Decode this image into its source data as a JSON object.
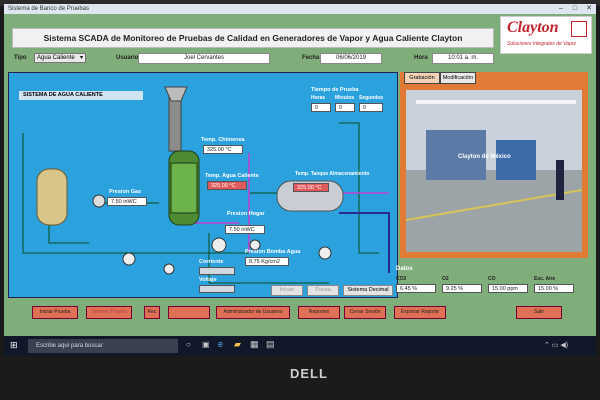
{
  "window": {
    "title": "Sistema de Banco de Pruebas"
  },
  "header": {
    "title": "Sistema SCADA de Monitoreo de Pruebas de Calidad en Generadores de Vapor y Agua Caliente Clayton",
    "logo_text": "Clayton",
    "logo_tagline": "Soluciones Integrales de Vapor"
  },
  "info": {
    "tipo_label": "Tipo",
    "tipo_value": "Agua Caliente",
    "usuario_label": "Usuario",
    "usuario_value": "Joel Cervantes",
    "fecha_label": "Fecha",
    "fecha_value": "06/06/2019",
    "hora_label": "Hora",
    "hora_value": "10:01 a. m."
  },
  "process": {
    "panel_title": "SISTEMA DE AGUA CALIENTE",
    "tiempo_label": "Tiempo de Prueba",
    "tiempo_cols": [
      "Horas",
      "Minutos",
      "Segundos"
    ],
    "tiempo_vals": [
      "0",
      "0",
      "0"
    ],
    "temp_chimenea_label": "Temp. Chimenea",
    "temp_chimenea": "325.00 °C",
    "temp_agua_label": "Temp. Agua Caliente",
    "temp_agua": "325.00 °C",
    "temp_tanque_label": "Temp. Tanque Almacenamiento",
    "temp_tanque": "325.00 °C",
    "presion_gas_label": "Presion Gas",
    "presion_gas": "7.50 inWC",
    "presion_hogar_label": "Presion Hogar",
    "presion_hogar": "7.50 inWC",
    "presion_bomba_label": "Presion Bomba Agua",
    "presion_bomba": "8.75 Kg/cm2",
    "corriente_label": "Corriente",
    "voltaje_label": "Voltaje",
    "btn_start": "Iniciar",
    "btn_pause": "Pausa",
    "sistema_decimal": "Sistema Decimal"
  },
  "camera": {
    "tabs": [
      "Grabación",
      "Modificación"
    ],
    "overlay_text": "Clayton de México"
  },
  "datos": {
    "title": "Datos",
    "cols": [
      "CO2",
      "O2",
      "CO",
      "Exc. Aire"
    ],
    "vals": [
      "6.45 %",
      "9.25 %",
      "15.00 ppm",
      "15.00 %"
    ]
  },
  "bottom": {
    "buttons": [
      "Iniciar Prueba",
      "Detener Prueba",
      "Rec",
      "",
      "Administrador de Usuarios",
      "Reportes",
      "Cerrar Sesión",
      "Exportar Reporte",
      "Salir"
    ]
  },
  "taskbar": {
    "search_placeholder": "Escribe aquí para buscar"
  },
  "bezel": {
    "brand": "DELL"
  }
}
